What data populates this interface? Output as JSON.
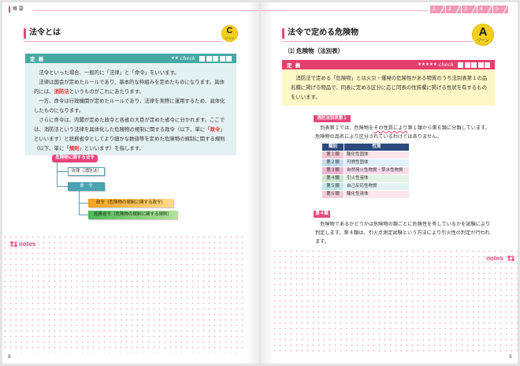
{
  "header": {
    "section_label": "概 要",
    "chapter_tabs": [
      "1",
      "2",
      "3",
      "4",
      "5"
    ]
  },
  "left_page": {
    "title": "法令とは",
    "zone_badge": {
      "letter": "C",
      "label": "ゾーン"
    },
    "definition": {
      "label": "定 義",
      "stars": "★★",
      "check_label": "check",
      "check_box_count": 5,
      "paragraphs": [
        [
          "法令といった場合、一般的に「法律」と「命令」をいいます。"
        ],
        [
          "法律は国会が定めたルールであり、基本的な枠組みを定めたものになります。具体的には、",
          "消防法",
          "というものがこれにあたります。"
        ],
        [
          "一方、命令は行政機関が定めたルールであり、法律を実際に運用するため、具体化したものになります。"
        ],
        [
          "さらに命令は、内閣が定めた政令と各省の大臣が定めた省令に分かれます。ここでは、消防法という法律を具体化した危険物の規制に関する政令（以下、単に「",
          "政令",
          "」といいます）と総務省令としてより細かな数値等を定めた危険物の規制に関する規則（以下、単に「",
          "規則",
          "」といいます）を指します。"
        ]
      ]
    },
    "diagram": {
      "title": "危険物に関する法令",
      "law": "法律（消防法）",
      "order": "命　令",
      "cabinet_order": "政令（危険物の規制に関する政令）",
      "ministerial_ordinance": "総務省令（危険物の規制に関する規則）"
    },
    "notes_label": "notes",
    "page_number": "8"
  },
  "right_page": {
    "title": "法令で定める危険物",
    "zone_badge": {
      "letter": "A",
      "label": "ゾーン"
    },
    "subheading": "⑴ 危険物（法別表）",
    "definition": {
      "label": "定 義",
      "stars": "★★★★★",
      "check_label": "check",
      "check_box_count": 5,
      "text": "消防法で定める「危険物」とは火災・爆発の危険性がある物質のうち法別表第１の品名欄に掲げる物品で、同表に定める区分に応じ同表の性質欄に掲げる性状を有するものをいいます。"
    },
    "annex_section": {
      "label": "消防法別表第１",
      "text": [
        "別表第１では、危険物を",
        "その性質により",
        "第１類から第６類に分類しています。危険物の品名により区分されているわけではありません。"
      ],
      "table": {
        "headers": [
          "類別",
          "性質"
        ],
        "rows": [
          [
            "第１類",
            "酸化性固体"
          ],
          [
            "第２類",
            "可燃性固体"
          ],
          [
            "第３類",
            "自然発火性物質・禁水性物質"
          ],
          [
            "第４類",
            "引火性液体"
          ],
          [
            "第５類",
            "自己反応性物質"
          ],
          [
            "第６類",
            "酸化性液体"
          ]
        ]
      }
    },
    "class4_section": {
      "label": "第４類",
      "text": "危険物であるかどうかは危険物の類ごとに危険性を有しているかを試験により判定します。第４類は、引火点測定試験という方法により引火性の判定が行われます。"
    },
    "notes_label": "notes",
    "page_number": "9"
  },
  "colors": {
    "pink": "#e8467c",
    "teal": "#45a9a4",
    "red": "#e43f6a",
    "yellow": "#f5cf1f",
    "navy": "#2c4a7e"
  }
}
